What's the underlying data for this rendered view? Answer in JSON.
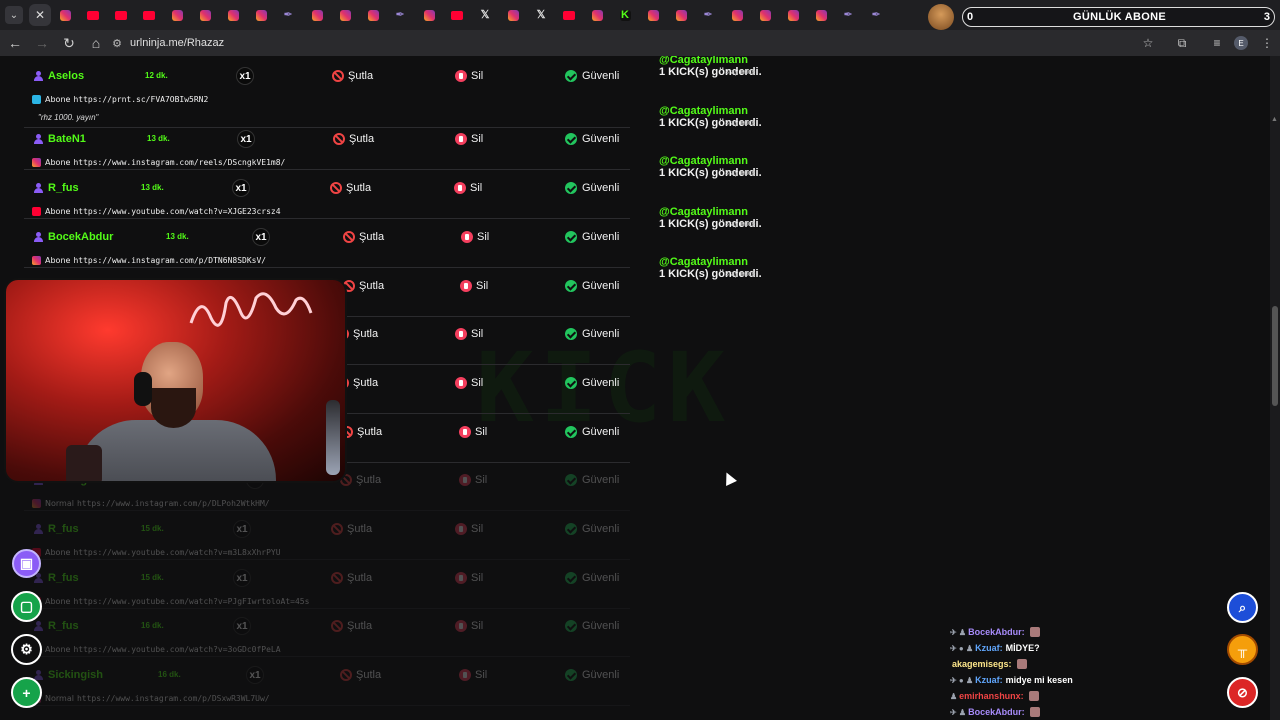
{
  "browser": {
    "url": "urlninja.me/Rhazaz",
    "tabs": [
      "ig",
      "yt",
      "yt",
      "yt",
      "ig",
      "ig",
      "ig",
      "ig",
      "feather",
      "ig",
      "ig",
      "ig",
      "feather",
      "ig",
      "yt",
      "x",
      "ig",
      "x",
      "yt",
      "ig",
      "kick",
      "ig",
      "ig",
      "feather",
      "ig",
      "ig",
      "ig",
      "ig",
      "feather",
      "feather"
    ],
    "profile_initial": "E"
  },
  "overlay": {
    "left_count": "0",
    "title": "GÜNLÜK ABONE",
    "right_count": "3"
  },
  "actions": {
    "kick": "Şutla",
    "delete": "Sil",
    "safe": "Güvenli"
  },
  "rows": [
    {
      "name": "Aselos",
      "time": "12 dk.",
      "mult": "x1",
      "src": "prnt",
      "type": "Abone",
      "link": "https://prnt.sc/FVA7OBIw5RN2",
      "note": "\"rhz 1000. yayın\""
    },
    {
      "name": "BateN1",
      "time": "13 dk.",
      "mult": "x1",
      "src": "ig",
      "type": "Abone",
      "link": "https://www.instagram.com/reels/DScngkVE1m8/",
      "note": ""
    },
    {
      "name": "R_fus",
      "time": "13 dk.",
      "mult": "x1",
      "src": "yt",
      "type": "Abone",
      "link": "https://www.youtube.com/watch?v=XJGE23crsz4",
      "note": ""
    },
    {
      "name": "BocekAbdur",
      "time": "13 dk.",
      "mult": "x1",
      "src": "ig",
      "type": "Abone",
      "link": "https://www.instagram.com/p/DTN6N8SDKsV/",
      "note": ""
    },
    {
      "name": "",
      "time": "",
      "mult": "",
      "src": "",
      "type": "",
      "link": "",
      "note": ""
    },
    {
      "name": "",
      "time": "",
      "mult": "",
      "src": "",
      "type": "",
      "link": "",
      "note": ""
    },
    {
      "name": "",
      "time": "",
      "mult": "",
      "src": "",
      "type": "",
      "link": "",
      "note": ""
    },
    {
      "name": "",
      "time": "",
      "mult": "",
      "src": "",
      "type": "",
      "link": "",
      "note": ""
    },
    {
      "name": "Sickingish",
      "time": "15 dk.",
      "mult": "x1",
      "src": "ig",
      "type": "Normal",
      "link": "https://www.instagram.com/p/DLPoh2WtkHM/",
      "note": ""
    },
    {
      "name": "R_fus",
      "time": "15 dk.",
      "mult": "x1",
      "src": "yt",
      "type": "Abone",
      "link": "https://www.youtube.com/watch?v=m3L8xXhrPYU",
      "note": ""
    },
    {
      "name": "R_fus",
      "time": "15 dk.",
      "mult": "x1",
      "src": "yt",
      "type": "Abone",
      "link": "https://www.youtube.com/watch?v=PJgFIwrtoloAt=45s",
      "note": ""
    },
    {
      "name": "R_fus",
      "time": "16 dk.",
      "mult": "x1",
      "src": "yt",
      "type": "Abone",
      "link": "https://www.youtube.com/watch?v=3oGDc0fPeLA",
      "note": ""
    },
    {
      "name": "Sickingish",
      "time": "16 dk.",
      "mult": "x1",
      "src": "ig",
      "type": "Normal",
      "link": "https://www.instagram.com/p/DSxwR3WL7Uw/",
      "note": ""
    }
  ],
  "messages": [
    {
      "who": "@Cagataylimann",
      "what": "1 KICK(s) gönderdi.",
      "ago": "3 ay önce"
    },
    {
      "who": "@Cagataylimann",
      "what": "1 KICK(s) gönderdi.",
      "ago": "3 ay önce"
    },
    {
      "who": "@Cagataylimann",
      "what": "1 KICK(s) gönderdi.",
      "ago": "3 ay önce"
    },
    {
      "who": "@Cagataylimann",
      "what": "1 KICK(s) gönderdi.",
      "ago": "3 ay önce"
    },
    {
      "who": "@Cagataylimann",
      "what": "1 KICK(s) gönderdi.",
      "ago": "3 ay önce"
    }
  ],
  "watermark": "KICK",
  "chat": [
    {
      "user": "BocekAbdur:",
      "color": "#a78bfa",
      "msg": "",
      "badges": "✈ ♟"
    },
    {
      "user": "Kzuaf:",
      "color": "#60a5fa",
      "msg": "MİDYE?",
      "badges": "✈ ● ♟"
    },
    {
      "user": "akagemisegs:",
      "color": "#fde68a",
      "msg": "",
      "badges": ""
    },
    {
      "user": "Kzuaf:",
      "color": "#60a5fa",
      "msg": "midye mi kesen",
      "badges": "✈ ● ♟"
    },
    {
      "user": "emirhanshunx:",
      "color": "#ef4444",
      "msg": "",
      "badges": "♟"
    },
    {
      "user": "BocekAbdur:",
      "color": "#a78bfa",
      "msg": "",
      "badges": "✈ ♟"
    }
  ]
}
